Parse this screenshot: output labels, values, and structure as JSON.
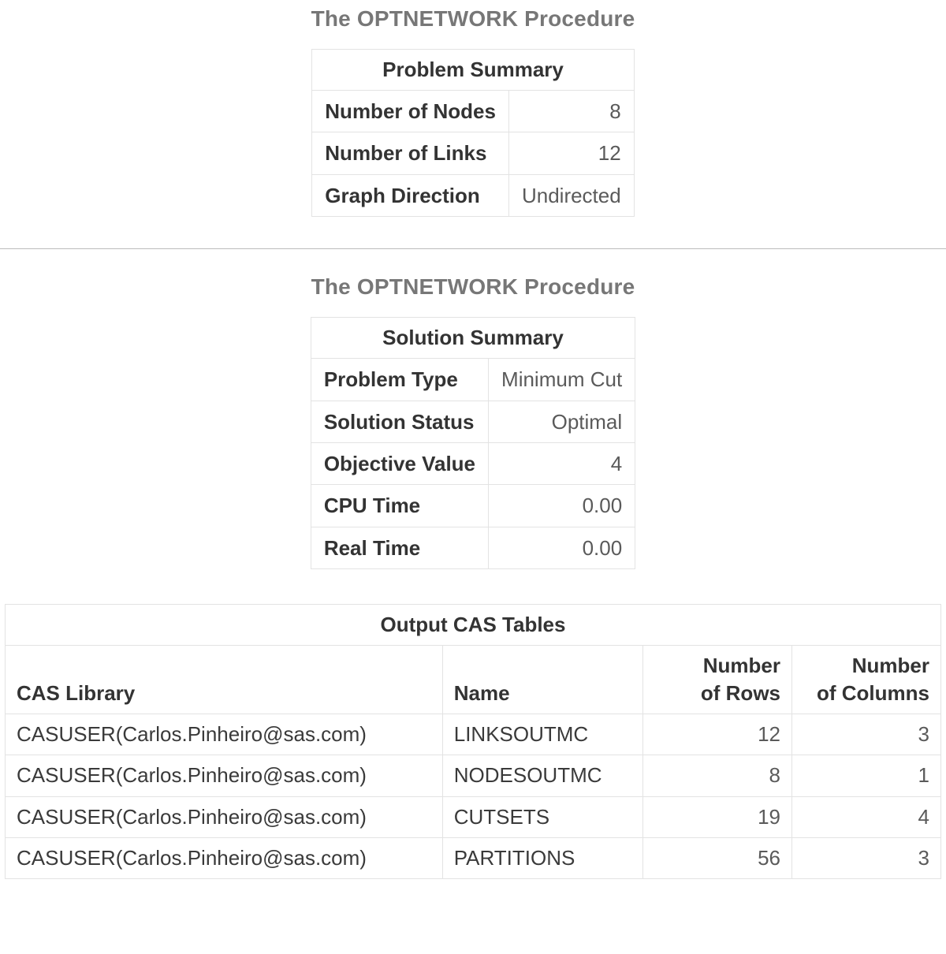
{
  "section1": {
    "title": "The OPTNETWORK Procedure",
    "problem_summary": {
      "caption": "Problem Summary",
      "rows": [
        {
          "label": "Number of Nodes",
          "value": "8"
        },
        {
          "label": "Number of Links",
          "value": "12"
        },
        {
          "label": "Graph Direction",
          "value": "Undirected"
        }
      ]
    }
  },
  "section2": {
    "title": "The OPTNETWORK Procedure",
    "solution_summary": {
      "caption": "Solution Summary",
      "rows": [
        {
          "label": "Problem Type",
          "value": "Minimum Cut"
        },
        {
          "label": "Solution Status",
          "value": "Optimal"
        },
        {
          "label": "Objective Value",
          "value": "4"
        },
        {
          "label": "CPU Time",
          "value": "0.00"
        },
        {
          "label": "Real Time",
          "value": "0.00"
        }
      ]
    },
    "output_cas_tables": {
      "caption": "Output CAS Tables",
      "headers": {
        "lib": "CAS Library",
        "name": "Name",
        "rows": "Number\nof Rows",
        "cols": "Number\nof Columns"
      },
      "rows": [
        {
          "lib": "CASUSER(Carlos.Pinheiro@sas.com)",
          "name": "LINKSOUTMC",
          "rows": "12",
          "cols": "3"
        },
        {
          "lib": "CASUSER(Carlos.Pinheiro@sas.com)",
          "name": "NODESOUTMC",
          "rows": "8",
          "cols": "1"
        },
        {
          "lib": "CASUSER(Carlos.Pinheiro@sas.com)",
          "name": "CUTSETS",
          "rows": "19",
          "cols": "4"
        },
        {
          "lib": "CASUSER(Carlos.Pinheiro@sas.com)",
          "name": "PARTITIONS",
          "rows": "56",
          "cols": "3"
        }
      ]
    }
  }
}
